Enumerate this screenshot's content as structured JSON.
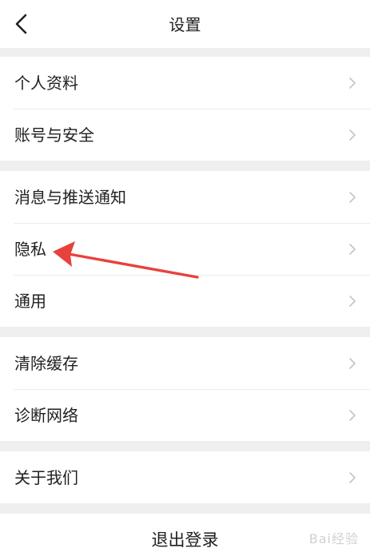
{
  "header": {
    "title": "设置",
    "back_icon": "chevron-left-icon"
  },
  "groups": [
    {
      "items": [
        {
          "label": "个人资料"
        },
        {
          "label": "账号与安全"
        }
      ]
    },
    {
      "items": [
        {
          "label": "消息与推送通知"
        },
        {
          "label": "隐私"
        },
        {
          "label": "通用"
        }
      ]
    },
    {
      "items": [
        {
          "label": "清除缓存"
        },
        {
          "label": "诊断网络"
        }
      ]
    },
    {
      "items": [
        {
          "label": "关于我们"
        }
      ]
    }
  ],
  "logout": {
    "label": "退出登录"
  },
  "annotation": {
    "color": "#e8413c",
    "points_to": "隐私"
  },
  "watermark": "Bai经验",
  "colors": {
    "background": "#efefef",
    "surface": "#ffffff",
    "text": "#1f1f1f",
    "chevron": "#c4c4c4",
    "divider": "#ececec"
  }
}
